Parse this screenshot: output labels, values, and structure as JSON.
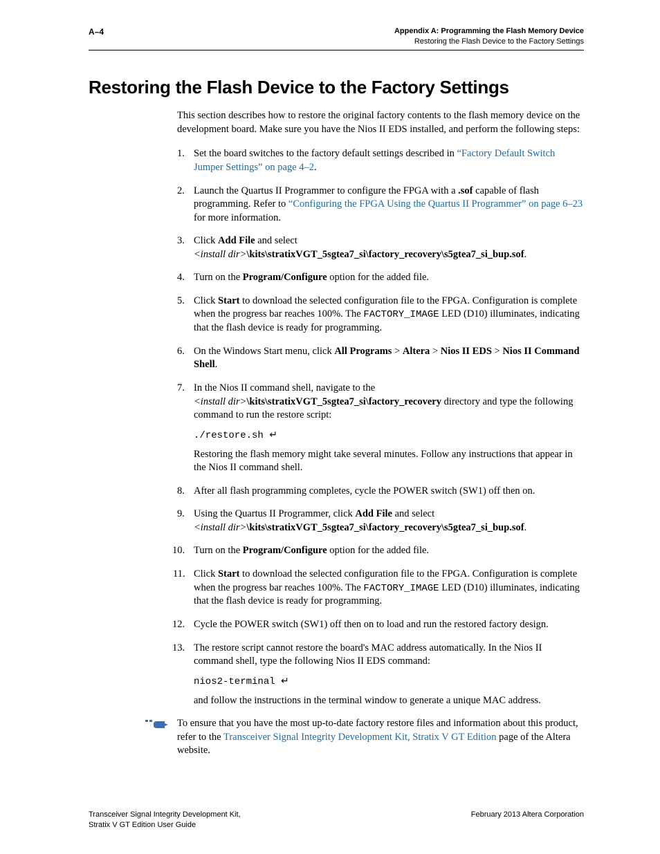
{
  "header": {
    "page_num": "A–4",
    "appendix_line": "Appendix A:  Programming the Flash Memory Device",
    "subtitle_line": "Restoring the Flash Device to the Factory Settings"
  },
  "title": "Restoring the Flash Device to the Factory Settings",
  "intro": "This section describes how to restore the original factory contents to the flash memory device on the development board. Make sure you have the Nios II EDS installed, and perform the following steps:",
  "steps": {
    "s1": {
      "pre": "Set the board switches to the factory default settings described in ",
      "link": "“Factory Default Switch Jumper Settings” on page 4–2",
      "post": "."
    },
    "s2": {
      "pre": "Launch the Quartus II Programmer to configure the FPGA with a ",
      "bold1": ".sof",
      "mid": " capable of flash programming. Refer to ",
      "link": "“Configuring the FPGA Using the Quartus II Programmer” on page 6–23",
      "post": " for more information."
    },
    "s3": {
      "pre": "Click ",
      "bold1": "Add File",
      "mid": " and select ",
      "italic": "<install dir>",
      "path": "\\kits\\stratixVGT_5sgtea7_si\\factory_recovery\\s5gtea7_si_bup.sof",
      "post": "."
    },
    "s4": {
      "pre": "Turn on the ",
      "bold1": "Program/Configure",
      "post": " option for the added file."
    },
    "s5": {
      "pre": "Click ",
      "bold1": "Start",
      "mid": " to download the selected configuration file to the FPGA. Configuration is complete when the progress bar reaches 100%. The ",
      "mono": "FACTORY_IMAGE",
      "post": " LED (D10) illuminates, indicating that the flash device is ready for programming."
    },
    "s6": {
      "pre": "On the Windows Start menu, click ",
      "b1": "All Programs",
      "g1": " > ",
      "b2": "Altera",
      "g2": " > ",
      "b3": "Nios II EDS",
      "g3": " > ",
      "b4": "Nios II Command Shell",
      "post": "."
    },
    "s7": {
      "pre": "In the Nios II command shell, navigate to the ",
      "italic": "<install dir>",
      "path": "\\kits\\stratixVGT_5sgtea7_si\\factory_recovery",
      "mid2": " directory and type the following command to run the restore script:",
      "cmd": "./restore.sh",
      "cmd_enter": "↵",
      "note": "Restoring the flash memory might take several minutes. Follow any instructions that appear in the Nios II command shell."
    },
    "s8": "After all flash programming completes, cycle the POWER switch (SW1) off then on.",
    "s9": {
      "pre": "Using the Quartus II Programmer, click ",
      "bold1": "Add File",
      "mid": " and select ",
      "italic": "<install dir>",
      "path": "\\kits\\stratixVGT_5sgtea7_si\\factory_recovery\\s5gtea7_si_bup.sof",
      "post": "."
    },
    "s10": {
      "pre": "Turn on the ",
      "bold1": "Program/Configure",
      "post": " option for the added file."
    },
    "s11": {
      "pre": "Click ",
      "bold1": "Start",
      "mid": " to download the selected configuration file to the FPGA. Configuration is complete when the progress bar reaches 100%. The ",
      "mono": "FACTORY_IMAGE",
      "post": " LED (D10) illuminates, indicating that the flash device is ready for programming."
    },
    "s12": "Cycle the POWER switch (SW1) off then on to load and run the restored factory design.",
    "s13": {
      "pre": "The restore script cannot restore the board's MAC address automatically. In the Nios II command shell, type the following Nios II EDS command:",
      "cmd": "nios2-terminal",
      "cmd_enter": "↵",
      "post": "and follow the instructions in the terminal window to generate a unique MAC address."
    }
  },
  "note": {
    "pre": "To ensure that you have the most up-to-date factory restore files and information about this product, refer to the ",
    "link": "Transceiver Signal Integrity Development Kit, Stratix V GT Edition",
    "post": " page of the Altera website."
  },
  "footer": {
    "left1": "Transceiver Signal Integrity Development Kit,",
    "left2": "Stratix V GT Edition User Guide",
    "right": "February 2013   Altera Corporation"
  }
}
